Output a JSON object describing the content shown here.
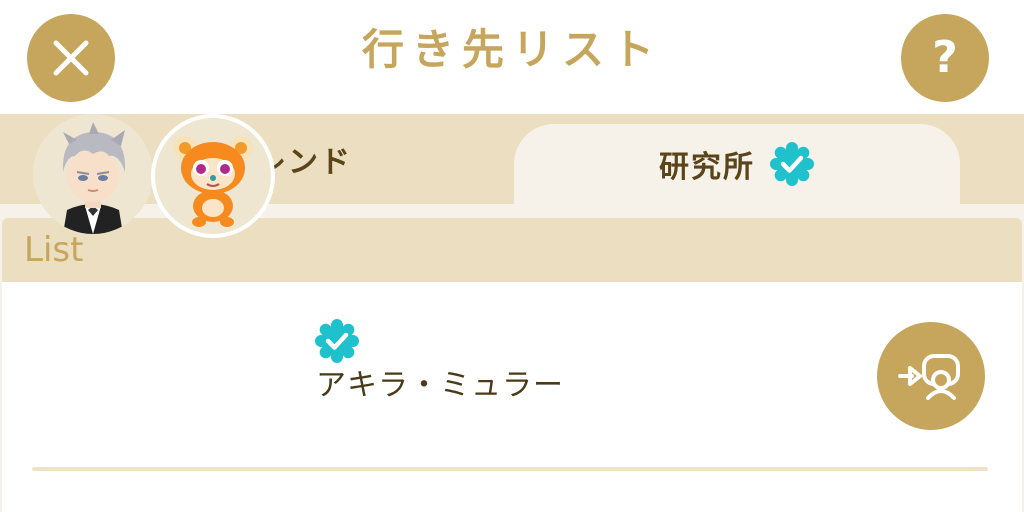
{
  "header": {
    "title": "行き先リスト",
    "close_icon": "close-icon",
    "help_label": "?"
  },
  "tabs": [
    {
      "label": "フレンド",
      "selected": false
    },
    {
      "label": "研究所",
      "selected": true,
      "badge_icon": "verified-badge-icon"
    }
  ],
  "list": {
    "section_label": "List",
    "items": [
      {
        "name": "アキラ・ミュラー",
        "badge_icon": "verified-badge-icon",
        "avatars": [
          "character-avatar",
          "pet-avatar"
        ],
        "action_icon": "visit-icon"
      }
    ]
  },
  "colors": {
    "accent_gold": "#c6a65c",
    "tab_bar": "#ecdfc1",
    "selected_tab": "#f6f2ea",
    "badge_teal": "#1fc1cc",
    "text_dark": "#4a3a1a"
  }
}
